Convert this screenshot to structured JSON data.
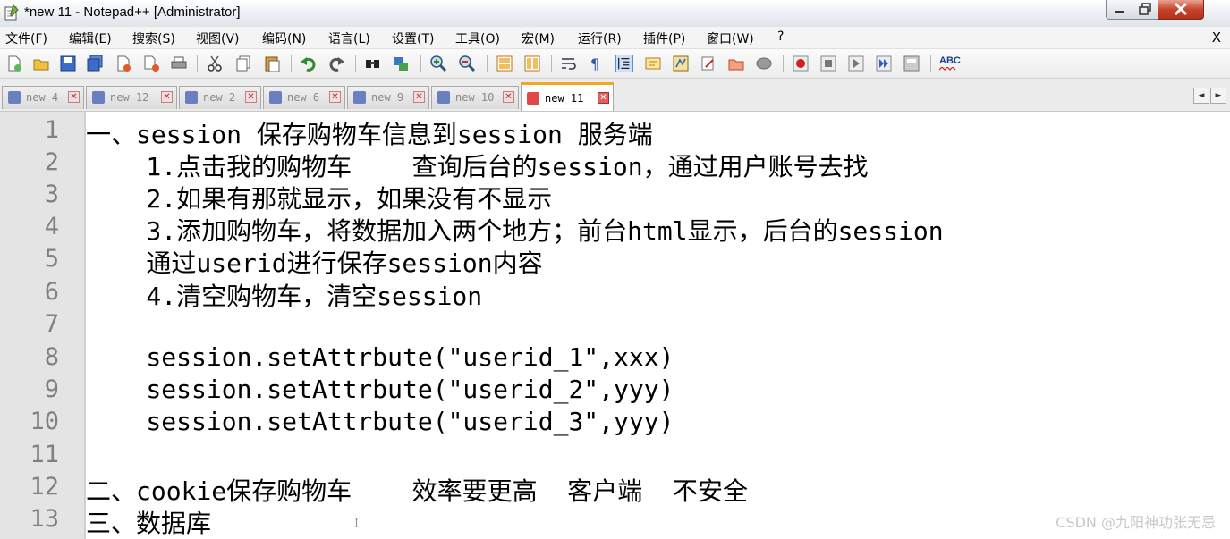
{
  "window": {
    "title": "*new 11 - Notepad++ [Administrator]",
    "close_glyph": "X"
  },
  "menu": {
    "items": [
      "文件(F)",
      "编辑(E)",
      "搜索(S)",
      "视图(V)",
      "编码(N)",
      "语言(L)",
      "设置(T)",
      "工具(O)",
      "宏(M)",
      "运行(R)",
      "插件(P)",
      "窗口(W)",
      "?"
    ]
  },
  "toolbar": {
    "icons": [
      "new-file-icon",
      "open-file-icon",
      "save-icon",
      "save-all-icon",
      "close-icon",
      "close-all-icon",
      "print-icon",
      "cut-icon",
      "copy-icon",
      "paste-icon",
      "undo-icon",
      "redo-icon",
      "find-icon",
      "replace-icon",
      "zoom-in-icon",
      "zoom-out-icon",
      "sync-vertical-icon",
      "sync-horizontal-icon",
      "word-wrap-icon",
      "show-all-chars-icon",
      "indent-guide-icon",
      "doc-map-icon",
      "function-list-icon",
      "folder-workspace-icon",
      "monitoring-icon",
      "record-macro-icon",
      "stop-macro-icon",
      "play-macro-icon",
      "run-macro-multiple-icon",
      "save-macro-icon",
      "spell-check-icon"
    ],
    "spell_check_label": "ABC"
  },
  "tabs": [
    {
      "label": "new 4",
      "active": false
    },
    {
      "label": "new 12",
      "active": false
    },
    {
      "label": "new 2",
      "active": false
    },
    {
      "label": "new 6",
      "active": false
    },
    {
      "label": "new 9",
      "active": false
    },
    {
      "label": "new 10",
      "active": false
    },
    {
      "label": "new 11",
      "active": true
    }
  ],
  "tab_scroll": {
    "left": "◄",
    "right": "►"
  },
  "editor": {
    "lines": [
      {
        "num": "1",
        "text": "一、session 保存购物车信息到session 服务端"
      },
      {
        "num": "2",
        "text": "    1.点击我的购物车    查询后台的session，通过用户账号去找"
      },
      {
        "num": "3",
        "text": "    2.如果有那就显示，如果没有不显示"
      },
      {
        "num": "4",
        "text": "    3.添加购物车，将数据加入两个地方；前台html显示，后台的session"
      },
      {
        "num": "5",
        "text": "    通过userid进行保存session内容"
      },
      {
        "num": "6",
        "text": "    4.清空购物车，清空session"
      },
      {
        "num": "7",
        "text": ""
      },
      {
        "num": "8",
        "text": "    session.setAttrbute(\"userid_1\",xxx)"
      },
      {
        "num": "9",
        "text": "    session.setAttrbute(\"userid_2\",yyy)"
      },
      {
        "num": "10",
        "text": "    session.setAttrbute(\"userid_3\",yyy)"
      },
      {
        "num": "11",
        "text": ""
      },
      {
        "num": "12",
        "text": "二、cookie保存购物车    效率要更高  客户端  不安全"
      },
      {
        "num": "13",
        "text": "三、数据库"
      }
    ]
  },
  "watermark": "CSDN @九阳神功张无忌",
  "colors": {
    "active_tab_accent": "#f5a623",
    "close_button": "#c7442c",
    "gutter": "#e4e4e4"
  }
}
